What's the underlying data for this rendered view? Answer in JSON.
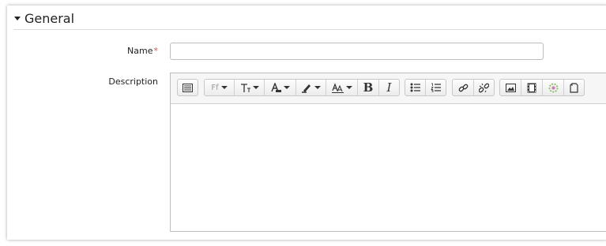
{
  "section": {
    "title": "General"
  },
  "fields": {
    "name": {
      "label": "Name",
      "required_mark": "*",
      "value": ""
    },
    "description": {
      "label": "Description",
      "value": ""
    }
  },
  "toolbar": {
    "groups": [
      [
        "show-more-buttons-icon"
      ],
      [
        "font-family-icon",
        "font-size-icon",
        "font-color-icon",
        "background-color-icon",
        "text-style-icon",
        "bold-icon",
        "italic-icon"
      ],
      [
        "unordered-list-icon",
        "ordered-list-icon"
      ],
      [
        "link-icon",
        "unlink-icon"
      ],
      [
        "image-icon",
        "media-icon",
        "recordrtc-icon",
        "manage-files-icon"
      ]
    ],
    "glyphs": {
      "font_family": "Ff",
      "bold": "B",
      "italic": "I"
    }
  },
  "colors": {
    "required": "#d9534f"
  }
}
